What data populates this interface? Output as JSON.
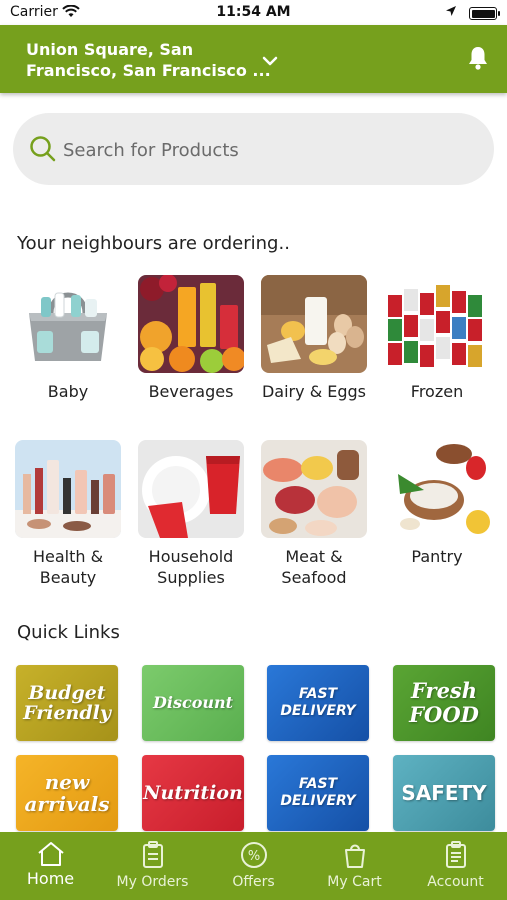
{
  "status_bar": {
    "carrier": "Carrier",
    "time": "11:54 AM"
  },
  "header": {
    "location_line1": "Union Square, San",
    "location_line2": "Francisco, San Francisco ...",
    "accent_color": "#76a01d"
  },
  "search": {
    "placeholder": "Search for Products"
  },
  "neighbours_section": {
    "title": "Your neighbours are ordering..",
    "categories": [
      {
        "label": "Baby"
      },
      {
        "label": "Beverages"
      },
      {
        "label": "Dairy & Eggs"
      },
      {
        "label": "Frozen"
      },
      {
        "label": "Health &\nBeauty"
      },
      {
        "label": "Household\nSupplies"
      },
      {
        "label": "Meat &\nSeafood"
      },
      {
        "label": "Pantry"
      }
    ]
  },
  "quick_links": {
    "title": "Quick Links",
    "items": [
      {
        "label": "Budget Friendly",
        "color": "#b5a31f"
      },
      {
        "label": "Discount",
        "color": "#6fbf63"
      },
      {
        "label": "FAST DELIVERY",
        "color": "#1e66c4"
      },
      {
        "label": "Fresh FOOD",
        "color": "#4f9a2c"
      },
      {
        "label": "new arrivals",
        "color": "#f0a81c"
      },
      {
        "label": "Nutrition",
        "color": "#d92b3a"
      },
      {
        "label": "FAST DELIVERY",
        "color": "#1e66c4"
      },
      {
        "label": "SAFETY",
        "color": "#4b9fb0"
      }
    ]
  },
  "bottom_nav": {
    "items": [
      {
        "label": "Home",
        "icon": "home-icon",
        "active": true
      },
      {
        "label": "My Orders",
        "icon": "orders-icon"
      },
      {
        "label": "Offers",
        "icon": "offers-icon"
      },
      {
        "label": "My Cart",
        "icon": "cart-icon"
      },
      {
        "label": "Account",
        "icon": "account-icon"
      }
    ]
  }
}
